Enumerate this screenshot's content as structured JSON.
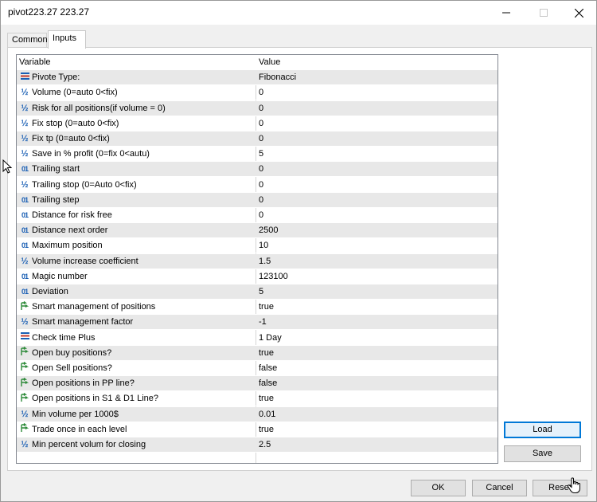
{
  "window": {
    "title": "pivot223.27 223.27"
  },
  "tabs": [
    {
      "label": "Common"
    },
    {
      "label": "Inputs"
    }
  ],
  "table": {
    "headers": {
      "variable": "Variable",
      "value": "Value"
    },
    "rows": [
      {
        "icon": "enum-icon",
        "variable": "Pivote Type:",
        "value": "Fibonacci"
      },
      {
        "icon": "double-icon",
        "variable": "Volume (0=auto 0<fix)",
        "value": "0"
      },
      {
        "icon": "double-icon",
        "variable": "Risk for all positions(if volume = 0)",
        "value": "0"
      },
      {
        "icon": "double-icon",
        "variable": "Fix stop (0=auto 0<fix)",
        "value": "0"
      },
      {
        "icon": "double-icon",
        "variable": "Fix tp (0=auto 0<fix)",
        "value": "0"
      },
      {
        "icon": "double-icon",
        "variable": "Save in % profit (0=fix 0<autu)",
        "value": "5"
      },
      {
        "icon": "int-icon",
        "variable": "Trailing start",
        "value": "0"
      },
      {
        "icon": "double-icon",
        "variable": "Trailing stop (0=Auto 0<fix)",
        "value": "0"
      },
      {
        "icon": "int-icon",
        "variable": "Trailing step",
        "value": "0"
      },
      {
        "icon": "int-icon",
        "variable": "Distance for risk free",
        "value": "0"
      },
      {
        "icon": "int-icon",
        "variable": "Distance next order",
        "value": "2500"
      },
      {
        "icon": "int-icon",
        "variable": "Maximum position",
        "value": "10"
      },
      {
        "icon": "double-icon",
        "variable": "Volume increase coefficient",
        "value": "1.5"
      },
      {
        "icon": "int-icon",
        "variable": "Magic number",
        "value": "123100"
      },
      {
        "icon": "int-icon",
        "variable": "Deviation",
        "value": "5"
      },
      {
        "icon": "bool-icon",
        "variable": "Smart management of positions",
        "value": "true"
      },
      {
        "icon": "double-icon",
        "variable": "Smart management factor",
        "value": "-1"
      },
      {
        "icon": "enum-icon",
        "variable": "Check time Plus",
        "value": "1 Day"
      },
      {
        "icon": "bool-icon",
        "variable": "Open buy positions?",
        "value": "true"
      },
      {
        "icon": "bool-icon",
        "variable": "Open Sell positions?",
        "value": "false"
      },
      {
        "icon": "bool-icon",
        "variable": "Open positions in PP line?",
        "value": "false"
      },
      {
        "icon": "bool-icon",
        "variable": "Open positions in S1 & D1 Line?",
        "value": "true"
      },
      {
        "icon": "double-icon",
        "variable": "Min volume per 1000$",
        "value": "0.01"
      },
      {
        "icon": "bool-icon",
        "variable": "Trade once in each level",
        "value": "true"
      },
      {
        "icon": "double-icon",
        "variable": "Min percent volum for closing",
        "value": "2.5"
      }
    ]
  },
  "side_buttons": {
    "load": "Load",
    "save": "Save"
  },
  "footer_buttons": {
    "ok": "OK",
    "cancel": "Cancel",
    "reset": "Reset"
  },
  "icon_glyphs": {
    "int": "01",
    "double": "½"
  },
  "colors": {
    "accent": "#0078d7",
    "alt_row": "#e8e8e8",
    "icon_blue": "#1a5fb4",
    "bool_green": "#2e8b3a"
  }
}
